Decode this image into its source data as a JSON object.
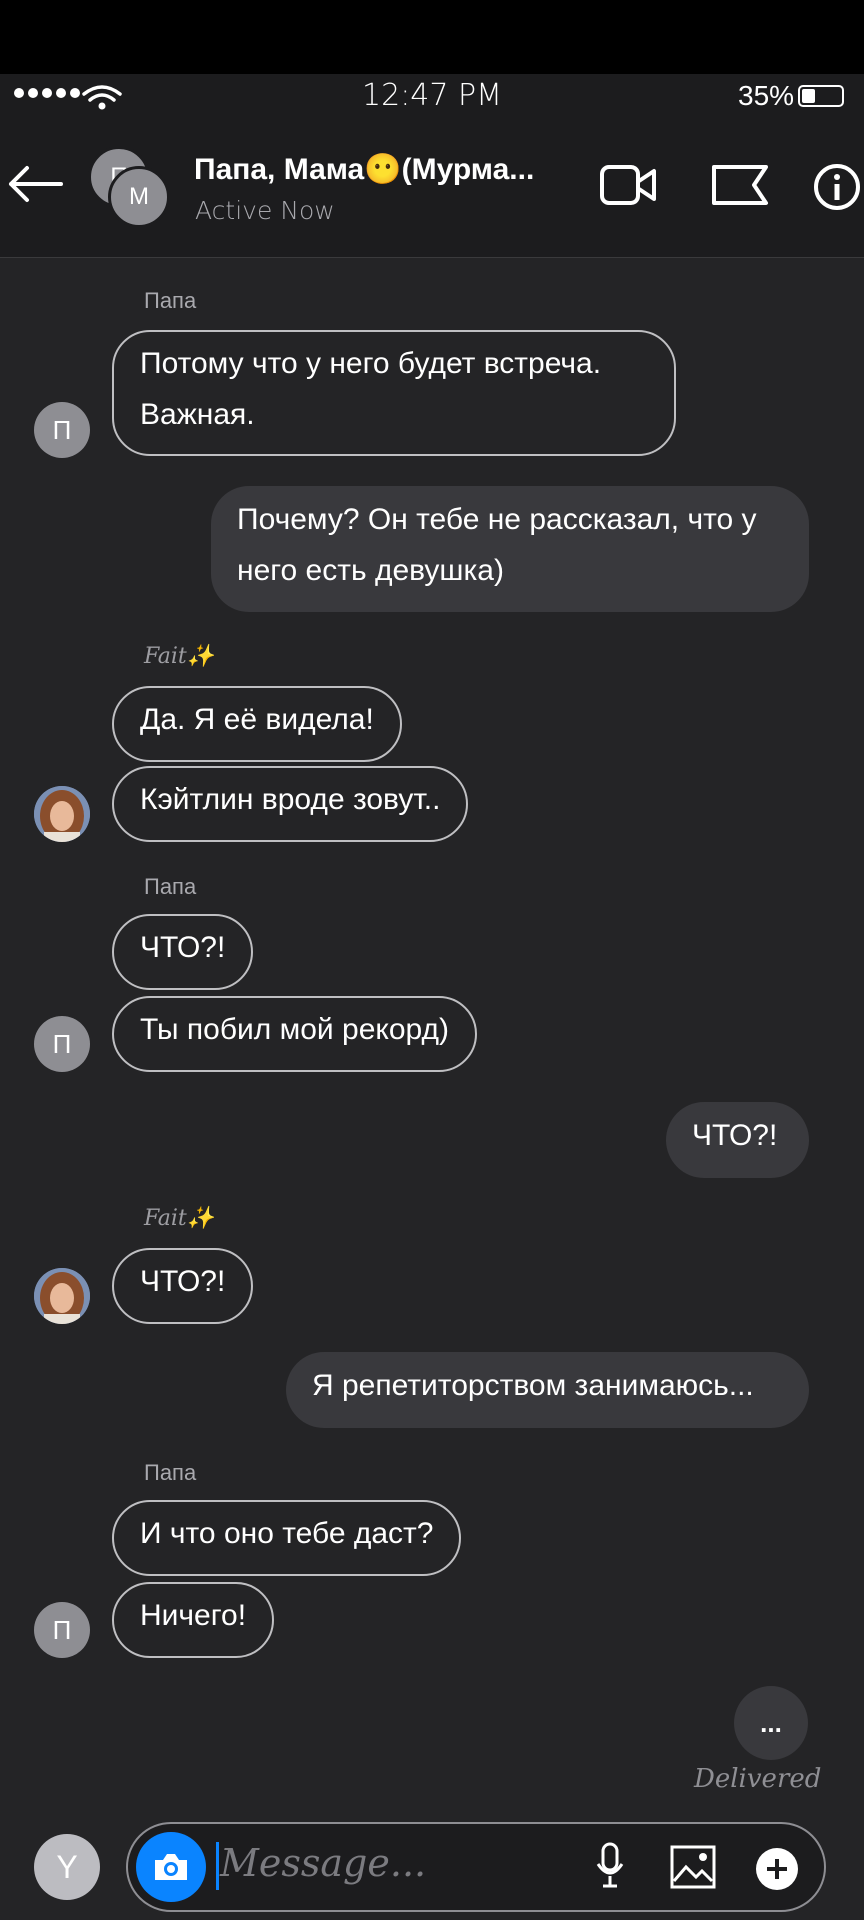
{
  "status_bar": {
    "time": "12:47 PM",
    "battery_pct": "35%",
    "battery_level": 0.35
  },
  "header": {
    "title": "Папа, Мама😶(Мурма...",
    "subtitle": "Active Now",
    "group_avatar_initials": [
      "П",
      "М"
    ],
    "icons": [
      "back-arrow-icon",
      "video-camera-icon",
      "flag-icon",
      "info-icon"
    ]
  },
  "messages": [
    {
      "sender": "Папа",
      "text": "Потому что у него будет встреча. Важная.",
      "direction": "in"
    },
    {
      "text": "Почему? Он тебе не рассказал, что у него есть девушка)",
      "direction": "out"
    },
    {
      "sender": "Fait✨",
      "text": "Да. Я её видела!",
      "direction": "in"
    },
    {
      "text": "Кэйтлин вроде зовут..",
      "direction": "in"
    },
    {
      "sender": "Папа",
      "text": "ЧТО?!",
      "direction": "in"
    },
    {
      "text": "Ты побил мой рекорд)",
      "direction": "in"
    },
    {
      "text": "ЧТО?!",
      "direction": "out"
    },
    {
      "sender": "Fait✨",
      "text": "ЧТО?!",
      "direction": "in"
    },
    {
      "text": "Я репетиторством занимаюсь...",
      "direction": "out"
    },
    {
      "sender": "Папа",
      "text": "И что оно тебе даст?",
      "direction": "in"
    },
    {
      "text": "Ничего!",
      "direction": "in"
    }
  ],
  "avatars": {
    "papa_initial": "П",
    "me_initial": "Y"
  },
  "typing_indicator": "...",
  "delivered": "Delivered",
  "composer": {
    "placeholder": "Message...",
    "icons": [
      "camera-icon",
      "microphone-icon",
      "gallery-icon",
      "plus-icon"
    ]
  },
  "colors": {
    "accent": "#0a84ff",
    "background": "#242426",
    "outgoing_bubble": "#39393d",
    "incoming_border": "#bfbfc2"
  }
}
